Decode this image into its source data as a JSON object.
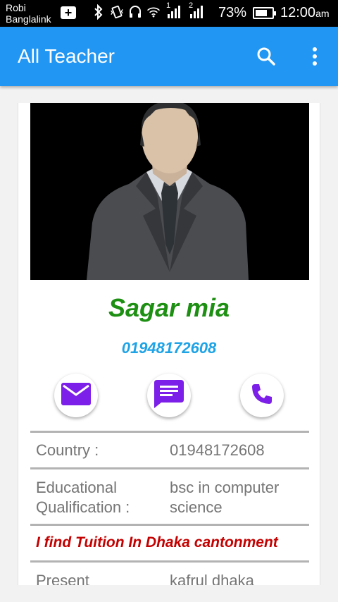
{
  "status_bar": {
    "carrier_line1": "Robi",
    "carrier_line2": "Banglalink",
    "battery_percent": "73%",
    "battery_level": 0.73,
    "time": "12:00",
    "time_suffix": "am",
    "sim1_label": "1",
    "sim2_label": "2",
    "icons": [
      "add-icon",
      "bluetooth-icon",
      "vibrate-icon",
      "headset-icon",
      "wifi-icon",
      "signal-icon",
      "signal-icon",
      "battery-icon"
    ]
  },
  "app_bar": {
    "title": "All Teacher",
    "color": "#2196f3",
    "search_icon": "search-icon",
    "menu_icon": "more-vert-icon"
  },
  "teacher": {
    "name": "Sagar mia",
    "phone": "01948172608",
    "name_color": "#1d8f12",
    "phone_color": "#1ea3e6",
    "photo_icon": "person-in-suit-image",
    "actions": [
      {
        "icon": "email-icon"
      },
      {
        "icon": "message-icon"
      },
      {
        "icon": "phone-icon"
      }
    ],
    "accent_icon_color": "#7c1fe8",
    "details": {
      "country_label": "Country :",
      "country_value": "01948172608",
      "edu_label": "Educational Qualification :",
      "edu_value": "bsc in computer science",
      "tuition_note": "I find Tuition In Dhaka cantonment",
      "present_label": "Present",
      "present_value": "kafrul dhaka"
    }
  }
}
